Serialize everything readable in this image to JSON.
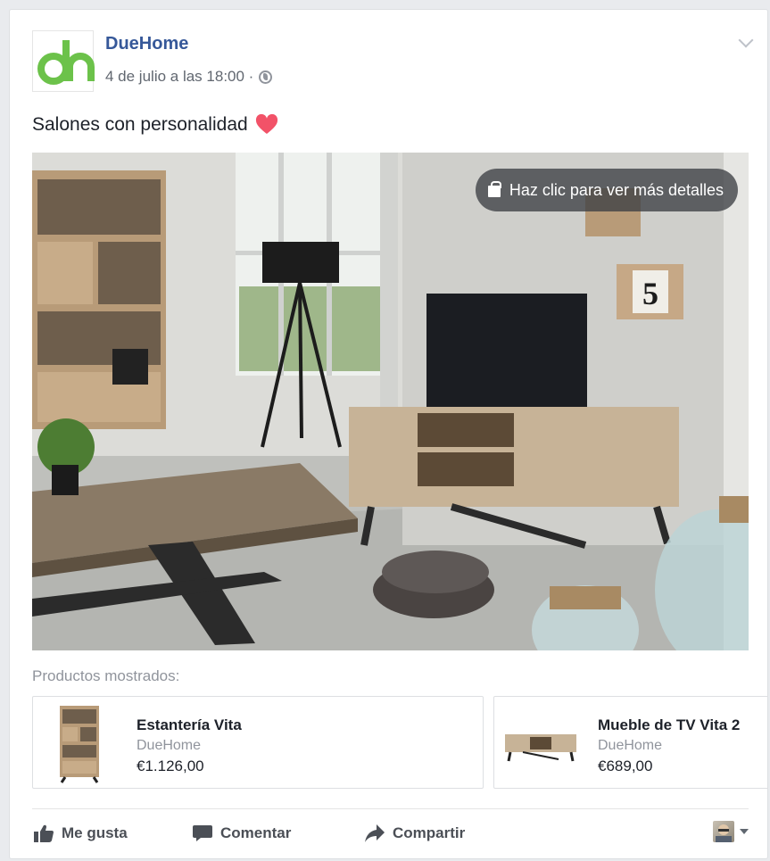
{
  "post": {
    "page_name": "DueHome",
    "timestamp": "4 de julio a las 18:00 ·",
    "caption": "Salones con personalidad",
    "caption_emoji": "heart",
    "brand_color": "#6cc24a",
    "link_color": "#365899"
  },
  "photo": {
    "cta_label": "Haz clic para ver más detalles",
    "wall_sign": "5"
  },
  "products": {
    "label": "Productos mostrados:",
    "items": [
      {
        "name": "Estantería Vita",
        "brand": "DueHome",
        "price": "€1.126,00"
      },
      {
        "name": "Mueble de TV Vita 2",
        "brand": "DueHome",
        "price": "€689,00"
      }
    ]
  },
  "actions": {
    "like": "Me gusta",
    "comment": "Comentar",
    "share": "Compartir"
  },
  "icons": [
    "page-logo-icon",
    "globe-icon",
    "chevron-down-icon",
    "heart-icon",
    "shopping-bag-icon",
    "thumbs-up-icon",
    "comment-icon",
    "share-arrow-icon",
    "avatar",
    "caret-down-icon"
  ]
}
